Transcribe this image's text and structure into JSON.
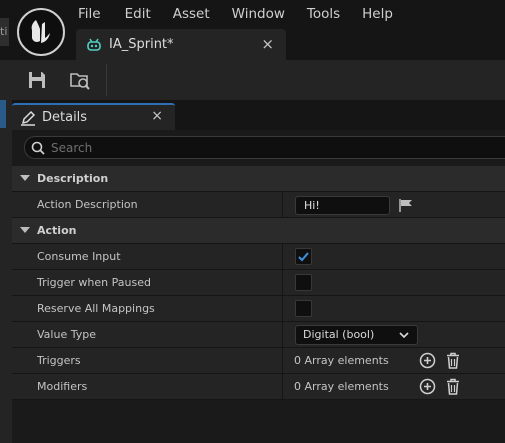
{
  "app": {
    "menu": [
      "File",
      "Edit",
      "Asset",
      "Window",
      "Tools",
      "Help"
    ],
    "left_sliver_text": "ti"
  },
  "document_tab": {
    "label": "IA_Sprint*",
    "close_glyph": "×",
    "icon": "input-action-icon"
  },
  "toolbar": {
    "buttons": [
      {
        "name": "save-button",
        "icon": "save-icon"
      },
      {
        "name": "browse-button",
        "icon": "browse-folder-icon"
      }
    ]
  },
  "panel": {
    "tab_label": "Details",
    "close_glyph": "×",
    "icon": "pencil-icon",
    "search_placeholder": "Search"
  },
  "details": {
    "description_category": "Description",
    "action_description_label": "Action Description",
    "action_description_value": "Hi!",
    "action_category": "Action",
    "consume_input_label": "Consume Input",
    "consume_input_checked": true,
    "trigger_when_paused_label": "Trigger when Paused",
    "trigger_when_paused_checked": false,
    "reserve_all_mappings_label": "Reserve All Mappings",
    "reserve_all_mappings_checked": false,
    "value_type_label": "Value Type",
    "value_type_value": "Digital (bool)",
    "triggers_label": "Triggers",
    "triggers_value": "0 Array elements",
    "modifiers_label": "Modifiers",
    "modifiers_value": "0 Array elements"
  },
  "colors": {
    "accent": "#2f6fb4",
    "checkbox_check": "#3d8fe0",
    "background": "#151515",
    "panel": "#242424"
  }
}
